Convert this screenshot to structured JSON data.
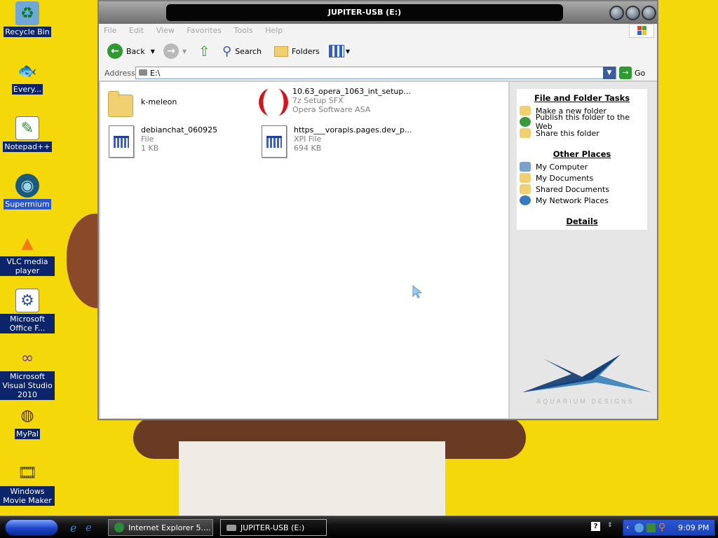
{
  "desktop": {
    "icons": [
      {
        "label": "Recycle Bin",
        "icon": "recycle-bin-icon"
      },
      {
        "label": "Every...",
        "icon": "fish-icon"
      },
      {
        "label": "Notepad++",
        "icon": "notepad-plus-plus-icon"
      },
      {
        "label": "Supermium",
        "icon": "supermium-icon"
      },
      {
        "label": "VLC media player",
        "icon": "vlc-cone-icon"
      },
      {
        "label": "Microsoft Office F...",
        "icon": "office-icon"
      },
      {
        "label": "Microsoft Visual Studio 2010",
        "icon": "visual-studio-icon"
      },
      {
        "label": "MyPal",
        "icon": "raccoon-icon"
      },
      {
        "label": "Windows Movie Maker",
        "icon": "movie-maker-icon"
      }
    ]
  },
  "window": {
    "title": "JUPITER-USB (E:)",
    "menu": [
      "File",
      "Edit",
      "View",
      "Favorites",
      "Tools",
      "Help"
    ],
    "toolbar": {
      "back": "Back",
      "search": "Search",
      "folders": "Folders"
    },
    "address": {
      "label": "Address",
      "value": "E:\\",
      "go": "Go"
    },
    "files": [
      {
        "name": "k-meleon",
        "sub1": "",
        "sub2": "",
        "type": "folder"
      },
      {
        "name": "10.63_opera_1063_int_setup...",
        "sub1": "7z Setup SFX",
        "sub2": "Opera Software ASA",
        "type": "opera"
      },
      {
        "name": "debianchat_060925",
        "sub1": "File",
        "sub2": "1 KB",
        "type": "doc"
      },
      {
        "name": "https___vorapis.pages.dev_p...",
        "sub1": "XPI File",
        "sub2": "694 KB",
        "type": "doc"
      }
    ],
    "sidepane": {
      "tasks_title": "File and Folder Tasks",
      "tasks": [
        "Make a new folder",
        "Publish this folder to the Web",
        "Share this folder"
      ],
      "places_title": "Other Places",
      "places": [
        "My Computer",
        "My Documents",
        "Shared Documents",
        "My Network Places"
      ],
      "details_title": "Details"
    }
  },
  "taskbar": {
    "tasks": [
      "Internet Explorer 5....",
      "JUPITER-USB (E:)"
    ],
    "clock": "9:09 PM"
  },
  "colors": {
    "wallpaper": "#f5d80a",
    "selection": "#0b246a",
    "accent": "#1941b8"
  }
}
